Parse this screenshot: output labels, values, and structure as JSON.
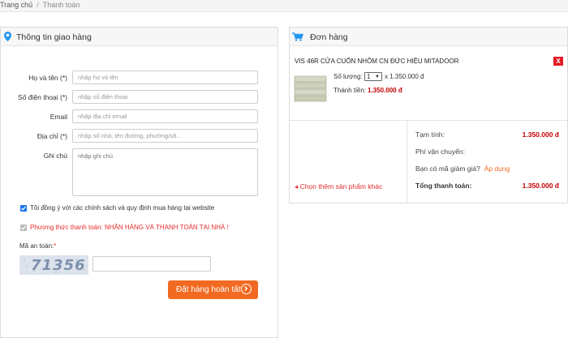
{
  "breadcrumb": {
    "home": "Trang chủ",
    "separator": "/",
    "current": "Thanh toán"
  },
  "shipping": {
    "title": "Thông tin giao hàng",
    "fields": {
      "name": {
        "label": "Họ và tên (*)",
        "placeholder": "nhập họ và tên"
      },
      "phone": {
        "label": "Số điện thoại (*)",
        "placeholder": "nhập số điện thoại"
      },
      "email": {
        "label": "Email",
        "placeholder": "nhập địa chỉ email"
      },
      "address": {
        "label": "Địa chỉ (*)",
        "placeholder": "nhập số nhà, tên đường, phường/xã..."
      },
      "note": {
        "label": "Ghi chú",
        "placeholder": "nhập ghi chú"
      }
    },
    "agree_text": "Tôi đồng ý với các chính sách và quy định mua hàng tại website",
    "payment_method": "Phương thức thanh toán: NHẬN HÀNG VÀ THANH TOÁN TẠI NHÀ !",
    "captcha_label": "Mã an toàn:",
    "captcha_required": "*",
    "captcha_code": "71356",
    "captcha_value": "",
    "submit_label": "Đặt hàng hoàn tất"
  },
  "order": {
    "title": "Đơn hàng",
    "product": {
      "name": "VIS 46R CỬA CUỐN NHÔM CN ĐỨC HIỆU MITADOOR",
      "remove_label": "X",
      "qty_label": "Số lượng:",
      "qty_value": "1",
      "unit_price": "x 1.350.000 đ",
      "total_label": "Thành tiền:",
      "total_value": "1.350.000 đ"
    },
    "continue_label": "Chọn thêm sản phẩm khác",
    "summary": {
      "subtotal_label": "Tạm tính:",
      "subtotal_value": "1.350.000 đ",
      "shipping_label": "Phí vận chuyển:",
      "discount_label": "Bạn có mã giảm giá?",
      "apply_label": "Áp dụng",
      "total_label": "Tổng thanh toán:",
      "total_value": "1.350.000 đ"
    }
  },
  "colors": {
    "accent": "#f26a21",
    "price": "#c40000",
    "link": "#1e90ff"
  }
}
